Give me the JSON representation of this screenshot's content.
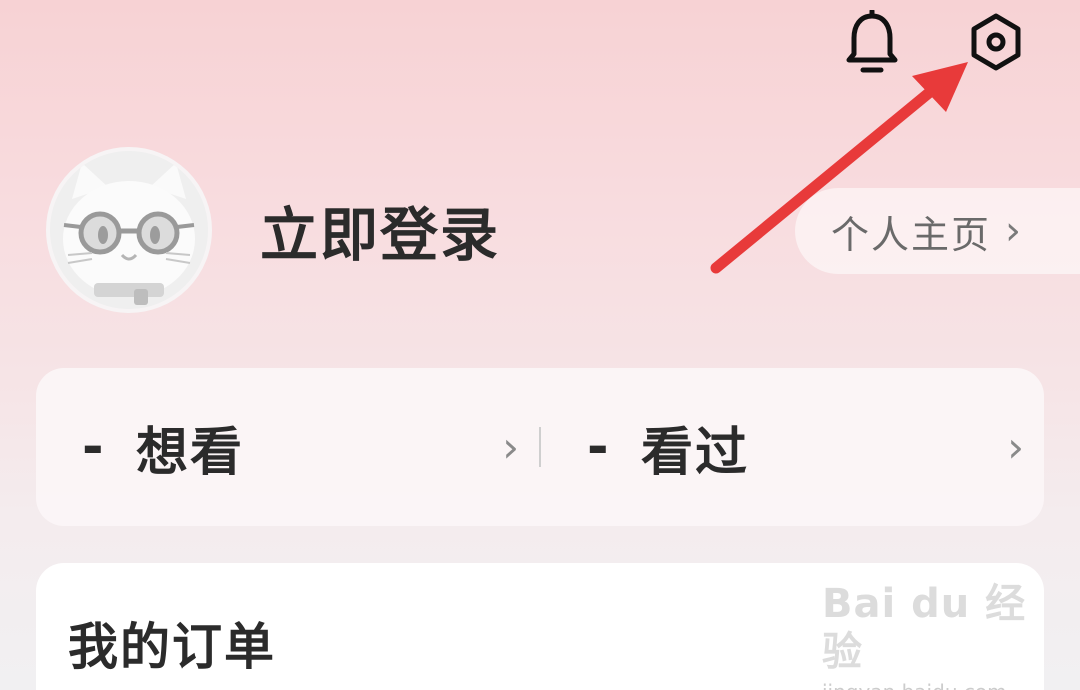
{
  "header": {
    "notification_icon": "bell-icon",
    "settings_icon": "hexagon-settings-icon"
  },
  "profile": {
    "avatar": "cat-with-glasses-avatar",
    "login_text": "立即登录",
    "homepage_label": "个人主页",
    "homepage_chevron": "›"
  },
  "stats": [
    {
      "count": "-",
      "label": "想看",
      "chevron": "›"
    },
    {
      "count": "-",
      "label": "看过",
      "chevron": "›"
    }
  ],
  "orders": {
    "title": "我的订单"
  },
  "watermark": {
    "logo": "Bai du 经验",
    "url": "jingyan.baidu.com"
  },
  "annotation": {
    "arrow_color": "#e83a3a"
  },
  "colors": {
    "background_top": "#f7d2d4",
    "text_primary": "#2b2b2b",
    "text_secondary": "#6a6a6a"
  }
}
